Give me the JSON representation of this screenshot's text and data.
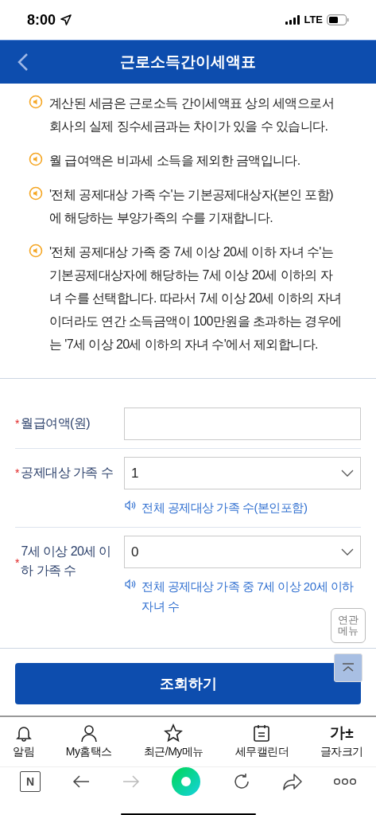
{
  "status_bar": {
    "time": "8:00",
    "network": "LTE"
  },
  "header": {
    "title": "근로소득간이세액표"
  },
  "notes": [
    "계산된 세금은 근로소득 간이세액표 상의 세액으로서 회사의 실제 징수세금과는 차이가 있을 수 있습니다.",
    "월 급여액은 비과세 소득을 제외한 금액입니다.",
    "'전체 공제대상 가족 수'는 기본공제대상자(본인 포함)에 해당하는 부양가족의 수를 기재합니다.",
    "'전체 공제대상 가족 중 7세 이상 20세 이하 자녀 수'는 기본공제대상자에 해당하는 7세 이상 20세 이하의 자녀 수를 선택합니다. 따라서 7세 이상 20세 이하의 자녀이더라도 연간 소득금액이 100만원을 초과하는 경우에는 '7세 이상 20세 이하의 자녀 수'에서 제외합니다."
  ],
  "form": [
    {
      "kind": "input",
      "required_mark": "*",
      "label": "월급여액(원)"
    },
    {
      "kind": "select",
      "required_mark": "*",
      "label": "공제대상 가족 수",
      "value": "1",
      "hint": "전체 공제대상 가족 수(본인포함)"
    },
    {
      "kind": "select",
      "required_mark": "*",
      "label": "7세 이상 20세 이하 가족 수",
      "value": "0",
      "hint": "전체 공제대상 가족 중 7세 이상 20세 이하 자녀 수"
    }
  ],
  "floating": {
    "related_menu": "연관 메뉴"
  },
  "submit_button": "조회하기",
  "bottom_nav": [
    {
      "kind": "bell",
      "label": "알림"
    },
    {
      "kind": "person",
      "label": "My홈택스"
    },
    {
      "kind": "star",
      "label": "최근/My메뉴"
    },
    {
      "kind": "calendar",
      "label": "세무캘린더"
    },
    {
      "kind": "font",
      "glyph": "가±",
      "label": "글자크기"
    }
  ],
  "browser_bar": [
    {
      "kind": "home",
      "glyph": "N",
      "disabled": false
    },
    {
      "kind": "back",
      "disabled": false
    },
    {
      "kind": "forward",
      "disabled": true
    },
    {
      "kind": "green",
      "disabled": false
    },
    {
      "kind": "reload",
      "disabled": false
    },
    {
      "kind": "share",
      "disabled": false
    },
    {
      "kind": "more",
      "disabled": false
    }
  ]
}
